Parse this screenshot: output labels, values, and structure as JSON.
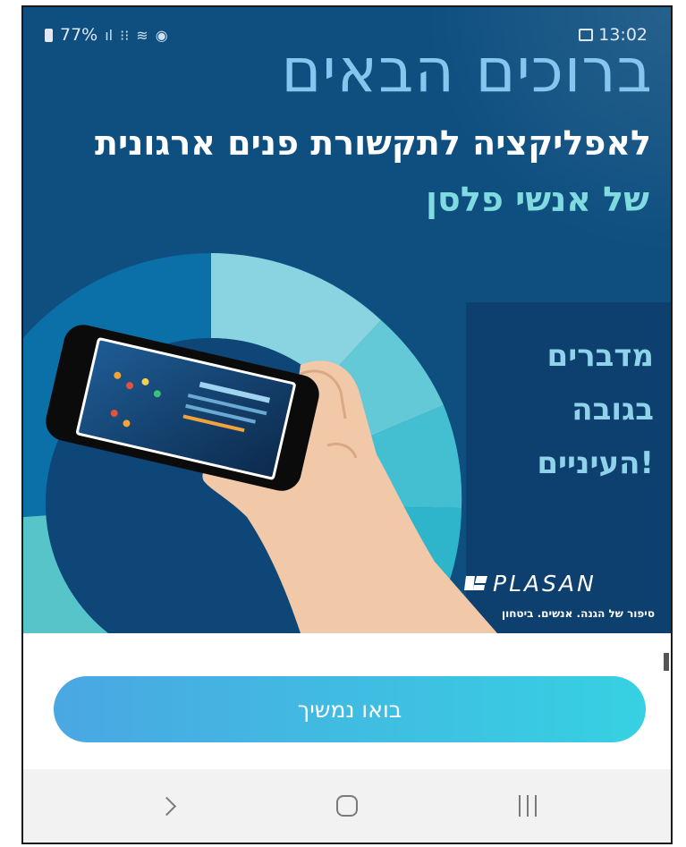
{
  "status_bar": {
    "battery": "77%",
    "time": "13:02",
    "icons": [
      "battery-icon",
      "signal-icon",
      "data-icon",
      "wifi-icon",
      "alarm-icon",
      "photo-icon"
    ]
  },
  "hero": {
    "title_line1": "ברוכים הבאים",
    "title_line2": "לאפליקציה לתקשורת פנים ארגונית",
    "title_line3": "של אנשי פלסן",
    "tagline": [
      "מדברים",
      "בגובה",
      "העיניים!"
    ],
    "brand_name": "PLASAN",
    "brand_slogan": "סיפור של הגנה. אנשים. ביטחון"
  },
  "actions": {
    "continue_label": "בואו נמשיך"
  },
  "nav_bar": {
    "items": [
      "back-icon",
      "home-icon",
      "recent-apps-icon"
    ]
  },
  "colors": {
    "hero_bg": "#0e4f80",
    "title_accent": "#86c6ee",
    "subtitle_accent": "#7fdbe0",
    "button_gradient_start": "#4aa7e2",
    "button_gradient_end": "#36d1e2"
  }
}
